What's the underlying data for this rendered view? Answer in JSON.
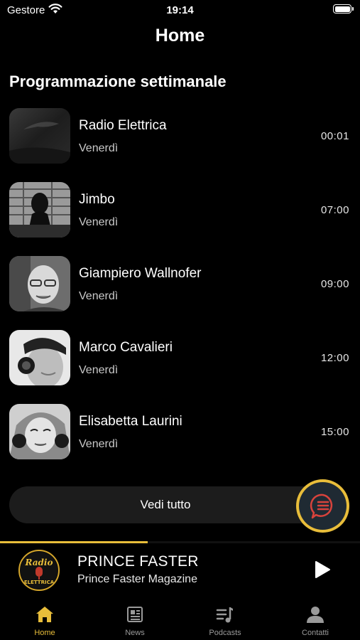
{
  "status_bar": {
    "carrier": "Gestore",
    "time": "19:14"
  },
  "header": {
    "title": "Home"
  },
  "schedule": {
    "title": "Programmazione settimanale",
    "items": [
      {
        "name": "Radio Elettrica",
        "day": "Venerdì",
        "time": "00:01"
      },
      {
        "name": "Jimbo",
        "day": "Venerdì",
        "time": "07:00"
      },
      {
        "name": "Giampiero Wallnofer",
        "day": "Venerdì",
        "time": "09:00"
      },
      {
        "name": "Marco Cavalieri",
        "day": "Venerdì",
        "time": "12:00"
      },
      {
        "name": "Elisabetta Laurini",
        "day": "Venerdì",
        "time": "15:00"
      }
    ],
    "see_all": "Vedi tutto"
  },
  "player": {
    "title": "PRINCE FASTER",
    "subtitle": "Prince Faster Magazine",
    "progress": 0.41,
    "logo_text_top": "Radio",
    "logo_text_bottom": "ELETTRICA"
  },
  "tabs": [
    {
      "label": "Home",
      "icon": "home-icon",
      "active": true
    },
    {
      "label": "News",
      "icon": "news-icon",
      "active": false
    },
    {
      "label": "Podcasts",
      "icon": "podcasts-icon",
      "active": false
    },
    {
      "label": "Contatti",
      "icon": "person-icon",
      "active": false
    }
  ],
  "colors": {
    "accent": "#e8bd3a",
    "background": "#000000",
    "chat_bg": "#1f2a33",
    "chat_lines": "#d8433c"
  }
}
